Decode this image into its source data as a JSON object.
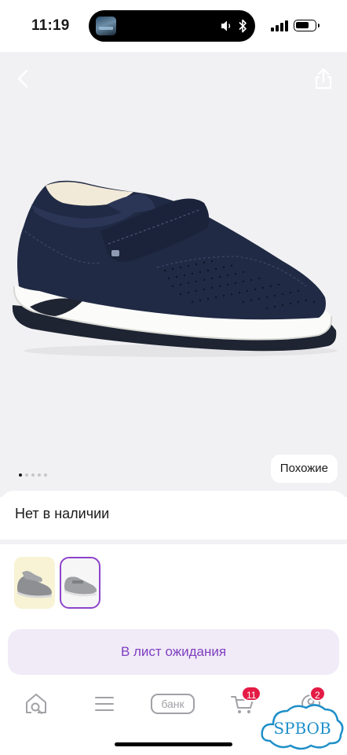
{
  "status_bar": {
    "time": "11:19"
  },
  "gallery": {
    "similar_label": "Похожие",
    "dot_count": 5,
    "active_dot": 0
  },
  "availability": {
    "text": "Нет в наличии"
  },
  "waitlist": {
    "label": "В лист ожидания"
  },
  "tabbar": {
    "bank_label": "банк",
    "cart_badge": "11",
    "profile_badge": "2"
  },
  "watermark": {
    "text": "SPBOB"
  },
  "colors": {
    "accent": "#7f3ec0",
    "accent_bg": "#f0ebf7",
    "badge": "#e31b45",
    "gallery_bg": "#f1f1f3",
    "selected_border": "#8e44c9",
    "watermark": "#1f8fc9"
  }
}
